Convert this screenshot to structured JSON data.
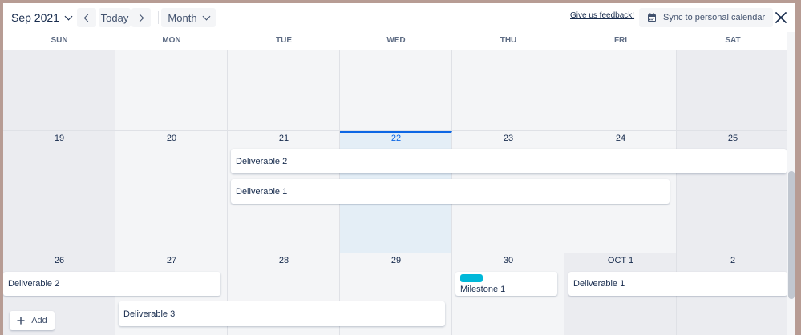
{
  "toolbar": {
    "month_label": "Sep 2021",
    "today_label": "Today",
    "view_label": "Month",
    "feedback_label": "Give us feedback!",
    "sync_label": "Sync to personal calendar"
  },
  "weekdays": [
    "SUN",
    "MON",
    "TUE",
    "WED",
    "THU",
    "FRI",
    "SAT"
  ],
  "weeks": [
    [
      "",
      "",
      "",
      "",
      "",
      "",
      ""
    ],
    [
      "19",
      "20",
      "21",
      "22",
      "23",
      "24",
      "25"
    ],
    [
      "26",
      "27",
      "28",
      "29",
      "30",
      "OCT 1",
      "2"
    ]
  ],
  "events": {
    "deliverable_2_a": "Deliverable 2",
    "deliverable_1_a": "Deliverable 1",
    "deliverable_2_b": "Deliverable 2",
    "milestone_1": "Milestone 1",
    "deliverable_1_b": "Deliverable 1",
    "deliverable_3": "Deliverable 3"
  },
  "add_label": "Add",
  "colors": {
    "today_accent": "#0c66e4",
    "milestone": "#00b8d9",
    "weekend": "#ebecf0",
    "today_bg": "#e4eef6"
  }
}
